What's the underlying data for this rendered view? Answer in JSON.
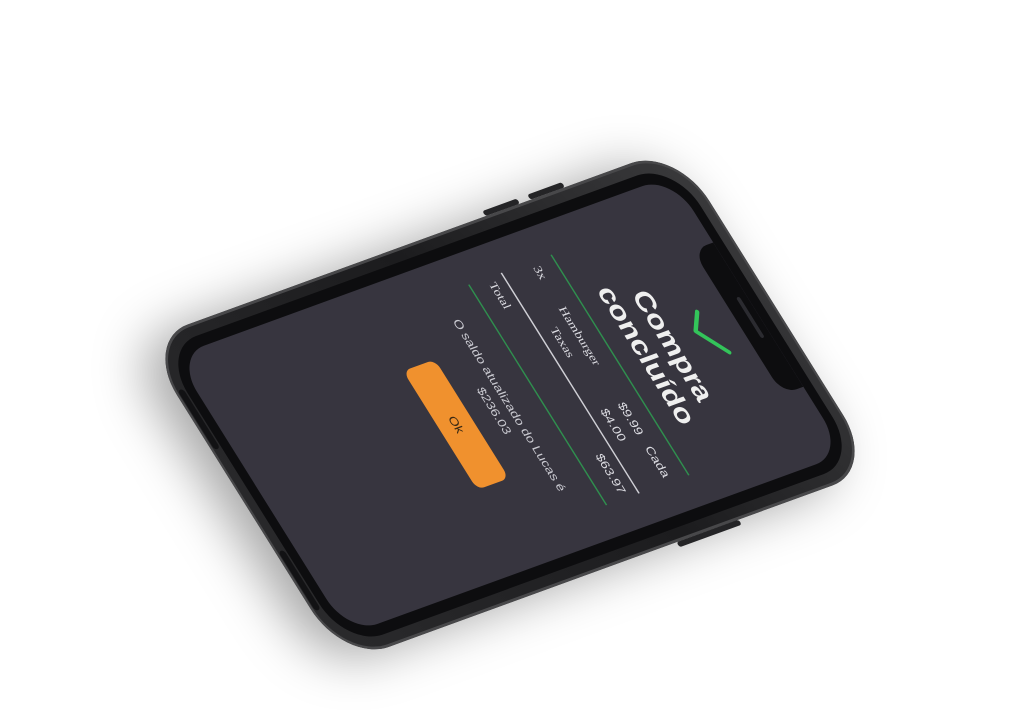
{
  "receipt": {
    "title": "Compra concluído",
    "items": [
      {
        "qty": "3x",
        "name": "Hamburger",
        "price": "$9.99",
        "each": "Cada"
      },
      {
        "qty": "",
        "name": "Taxas",
        "price": "$4.00",
        "each": ""
      }
    ],
    "total_label": "Total",
    "total_value": "$63.97",
    "balance_message": "O saldo atualizado do Lucas é $236.03",
    "ok_label": "Ok"
  },
  "colors": {
    "screen_bg": "#37353f",
    "accent_green": "#33c45a",
    "divider_green": "#2f8f4e",
    "button_orange": "#f0912e"
  },
  "icons": {
    "check": "check-icon"
  }
}
